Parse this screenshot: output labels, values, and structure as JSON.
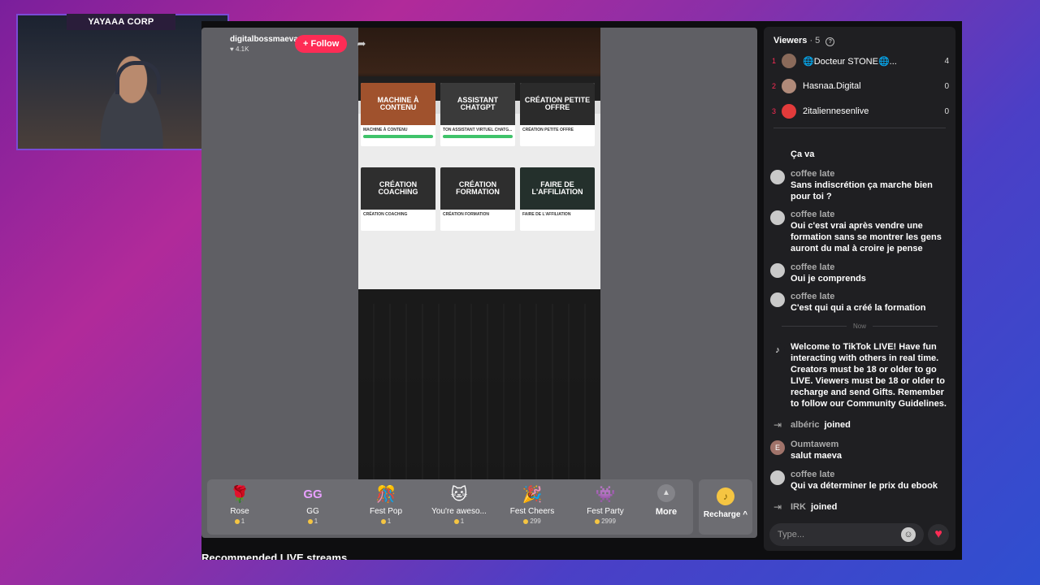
{
  "webcam": {
    "title": "YAYAAA CORP"
  },
  "stream": {
    "host_name": "digitalbossmaeva",
    "likes": "4.1K",
    "follow_label": "+ Follow"
  },
  "video_content": {
    "cards": [
      {
        "thumb": "MACHINE À CONTENU",
        "title": "MACHINE À CONTENU",
        "color": "#a0522d"
      },
      {
        "thumb": "ASSISTANT CHATGPT",
        "title": "TON ASSISTANT VIRTUEL CHATG...",
        "color": "#3a3a3a"
      },
      {
        "thumb": "CRÉATION PETITE OFFRE",
        "title": "CRÉATION PETITE OFFRE",
        "color": "#2b2b2b"
      },
      {
        "thumb": "CRÉATION COACHING",
        "title": "CRÉATION COACHING",
        "color": "#2e2e2e"
      },
      {
        "thumb": "CRÉATION FORMATION",
        "title": "CRÉATION FORMATION",
        "color": "#2e2e2e"
      },
      {
        "thumb": "FAIRE DE L'AFFILIATION",
        "title": "FAIRE DE L'AFFILIATION",
        "color": "#24302c"
      }
    ]
  },
  "gifts": [
    {
      "name": "Rose",
      "price": "1",
      "icon": "🌹"
    },
    {
      "name": "GG",
      "price": "1",
      "icon": "GG"
    },
    {
      "name": "Fest Pop",
      "price": "1",
      "icon": "🎊"
    },
    {
      "name": "You're aweso...",
      "price": "1",
      "icon": "🐱"
    },
    {
      "name": "Fest Cheers",
      "price": "299",
      "icon": "🎉"
    },
    {
      "name": "Fest Party",
      "price": "2999",
      "icon": "👾"
    }
  ],
  "more_label": "More",
  "recharge_label": "Recharge ^",
  "recommended_label": "Recommended LIVE streams",
  "viewers": {
    "title": "Viewers",
    "count": "· 5",
    "list": [
      {
        "rank": "1",
        "name": "🌐Docteur STONE🌐...",
        "score": "4",
        "color": "#8a6a5a"
      },
      {
        "rank": "2",
        "name": "Hasnaa.Digital",
        "score": "0",
        "color": "#b08a7a"
      },
      {
        "rank": "3",
        "name": "2italiennesenlive",
        "score": "0",
        "color": "#e23b3b"
      }
    ]
  },
  "chat": {
    "messages_top": [
      {
        "user": "",
        "text": "Ça va"
      },
      {
        "user": "coffee late",
        "text": "Sans indiscrétion ça marche bien pour toi ?"
      },
      {
        "user": "coffee late",
        "text": "Oui c'est vrai après vendre une formation sans se montrer les gens auront du mal à croire je pense"
      },
      {
        "user": "coffee late",
        "text": "Oui je comprends"
      },
      {
        "user": "coffee late",
        "text": "C'est qui qui a créé la formation"
      }
    ],
    "now_label": "Now",
    "welcome": "Welcome to TikTok LIVE! Have fun interacting with others in real time. Creators must be 18 or older to go LIVE. Viewers must be 18 or older to recharge and send Gifts. Remember to follow our Community Guidelines.",
    "joined1": {
      "user": "albéric",
      "text": "joined"
    },
    "msg_oumtawem": {
      "user": "Oumtawem",
      "text": "salut maeva",
      "initial": "E"
    },
    "msg_coffee_last": {
      "user": "coffee late",
      "text": "Qui va déterminer le prix du ebook"
    },
    "joined2": {
      "user": "IRK",
      "text": "joined"
    },
    "input_placeholder": "Type..."
  }
}
